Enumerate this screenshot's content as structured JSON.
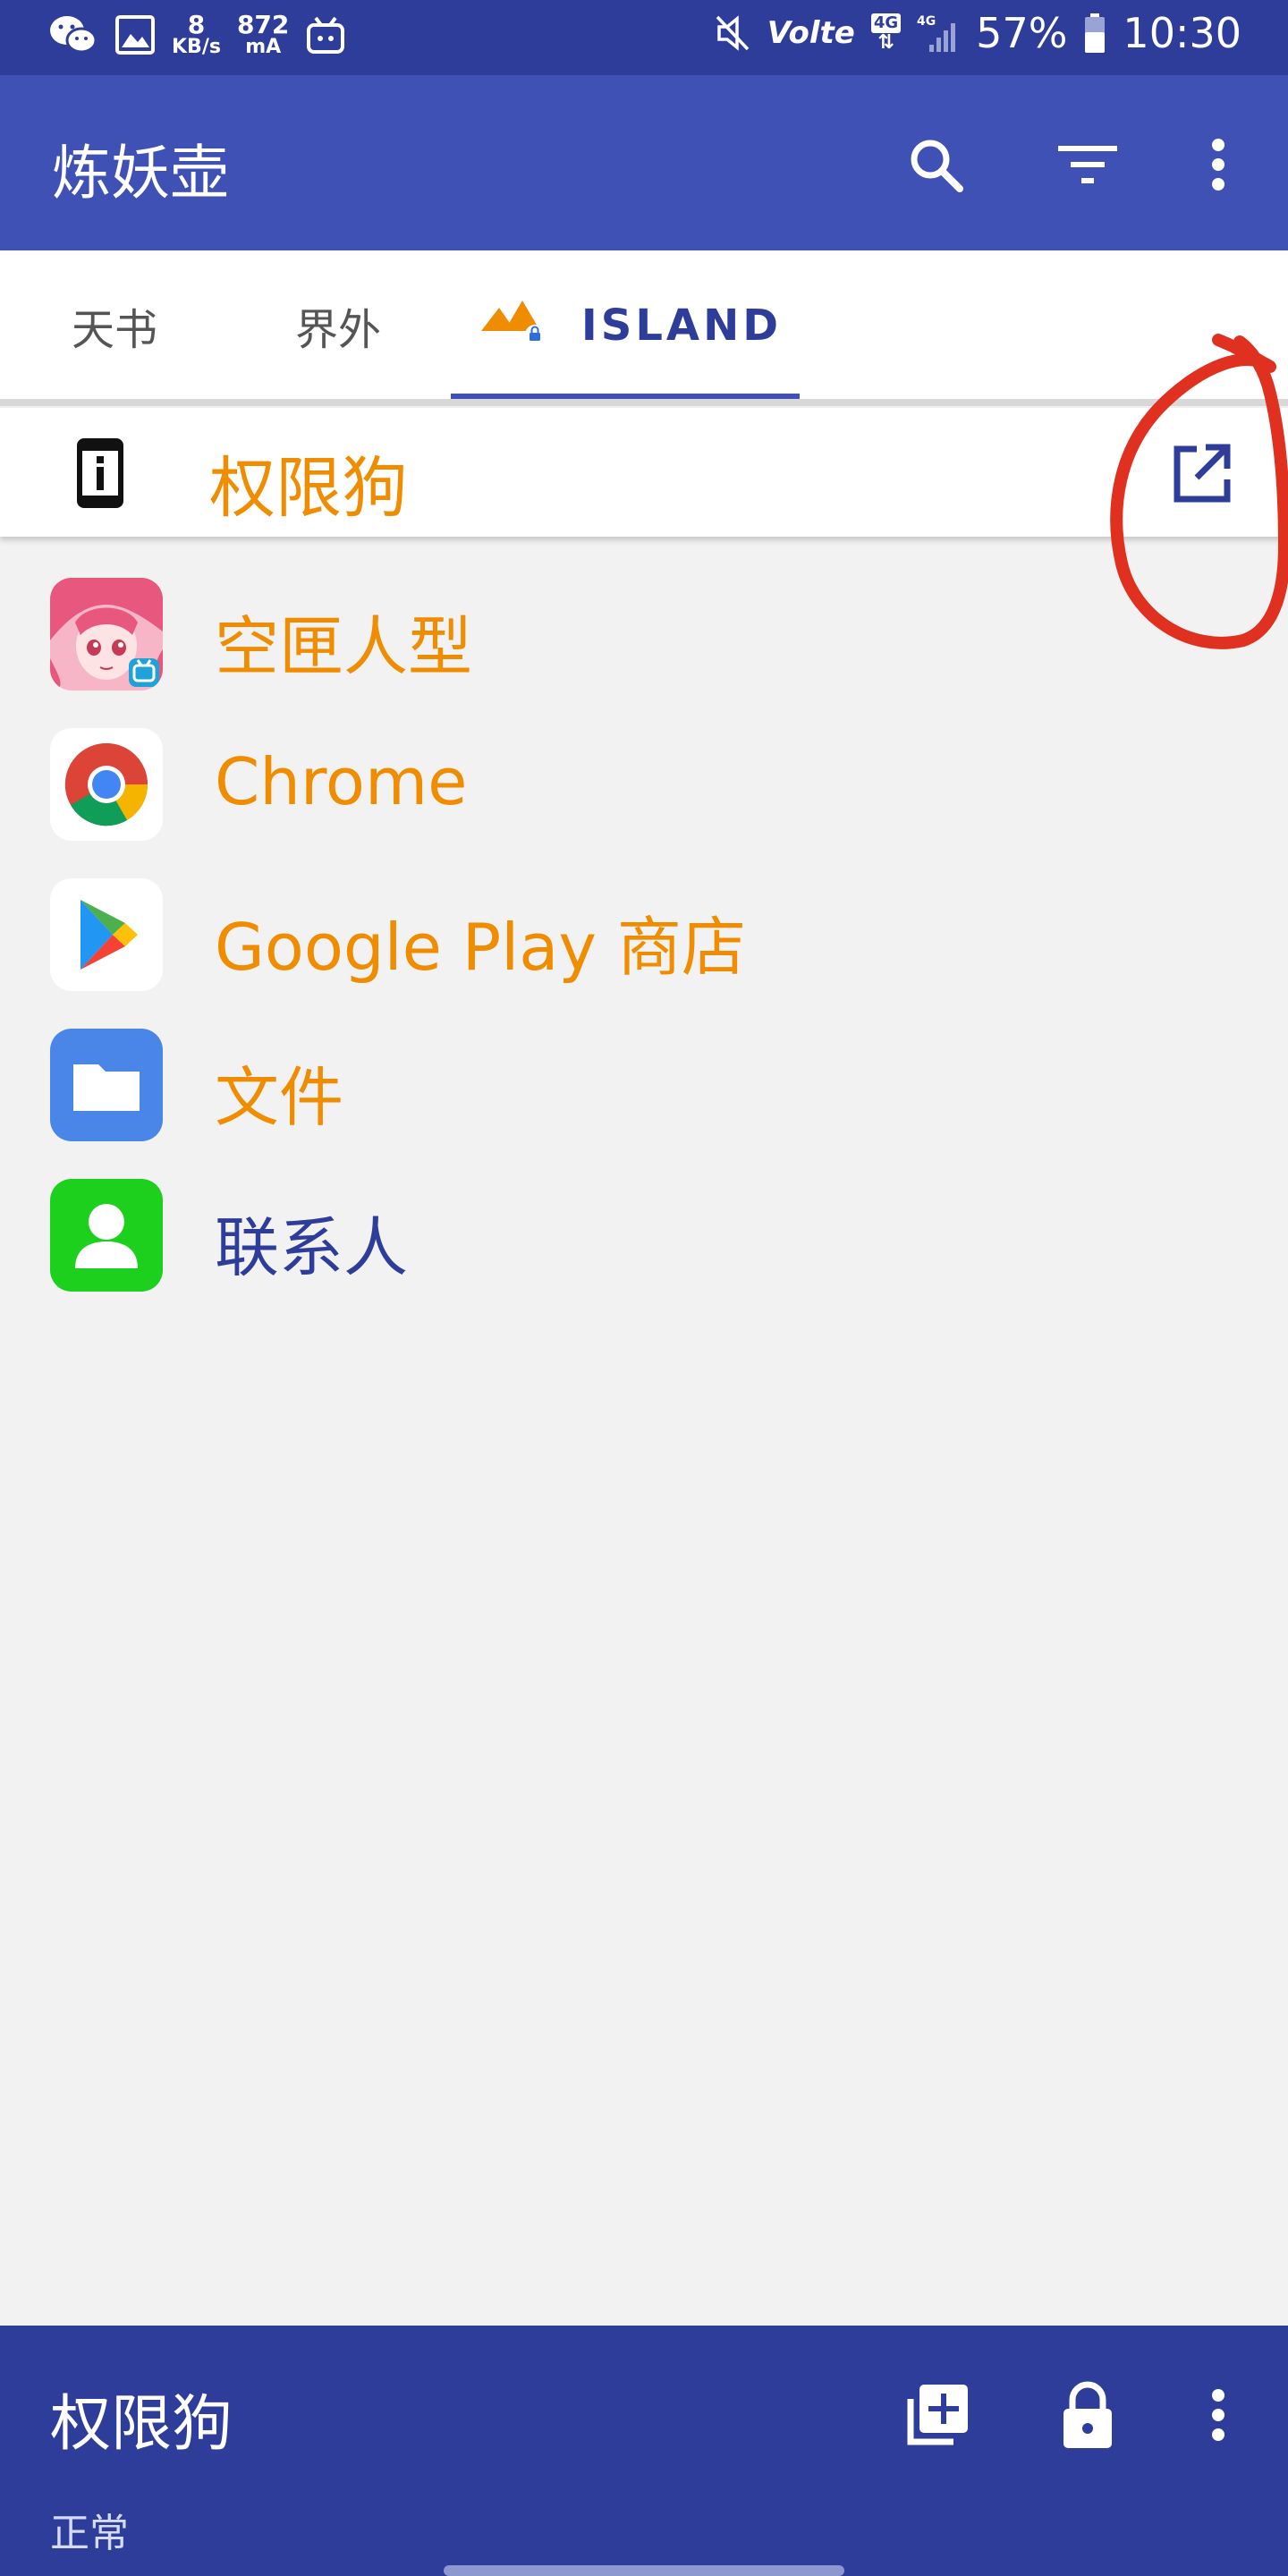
{
  "status_bar": {
    "net_speed_value": "8",
    "net_speed_unit": "KB/s",
    "current_value": "872",
    "current_unit": "mA",
    "volte": "Volte",
    "net_type_a": "4G",
    "net_type_b": "4G",
    "battery": "57%",
    "time": "10:30"
  },
  "app_bar": {
    "title": "炼妖壶",
    "icons": [
      "search-icon",
      "filter-icon",
      "more-vert-icon"
    ]
  },
  "tabs": {
    "items": [
      {
        "label": "天书",
        "active": false
      },
      {
        "label": "界外",
        "active": false
      },
      {
        "label": "ISLAND",
        "active": true,
        "icon": "island-mountains-icon"
      }
    ]
  },
  "selected_app": {
    "label": "权限狗",
    "icon": "phone-info-icon",
    "action_icon": "open-in-new-icon"
  },
  "apps": [
    {
      "label": "空匣人型",
      "icon": "anime-girl-app-icon",
      "state": "frozen"
    },
    {
      "label": "Chrome",
      "icon": "chrome-icon",
      "state": "frozen"
    },
    {
      "label": "Google Play 商店",
      "icon": "google-play-icon",
      "state": "frozen"
    },
    {
      "label": "文件",
      "icon": "files-folder-icon",
      "state": "frozen"
    },
    {
      "label": "联系人",
      "icon": "contacts-icon",
      "state": "normal"
    }
  ],
  "bottom_bar": {
    "title": "权限狗",
    "subtitle": "正常",
    "icons": [
      "add-to-library-icon",
      "lock-icon",
      "more-vert-icon"
    ]
  },
  "colors": {
    "status_bar": "#2e3c9a",
    "app_bar": "#3f51b5",
    "frozen_label": "#f08c00",
    "normal_label": "#2e3c9a",
    "annotation": "#e03020"
  }
}
